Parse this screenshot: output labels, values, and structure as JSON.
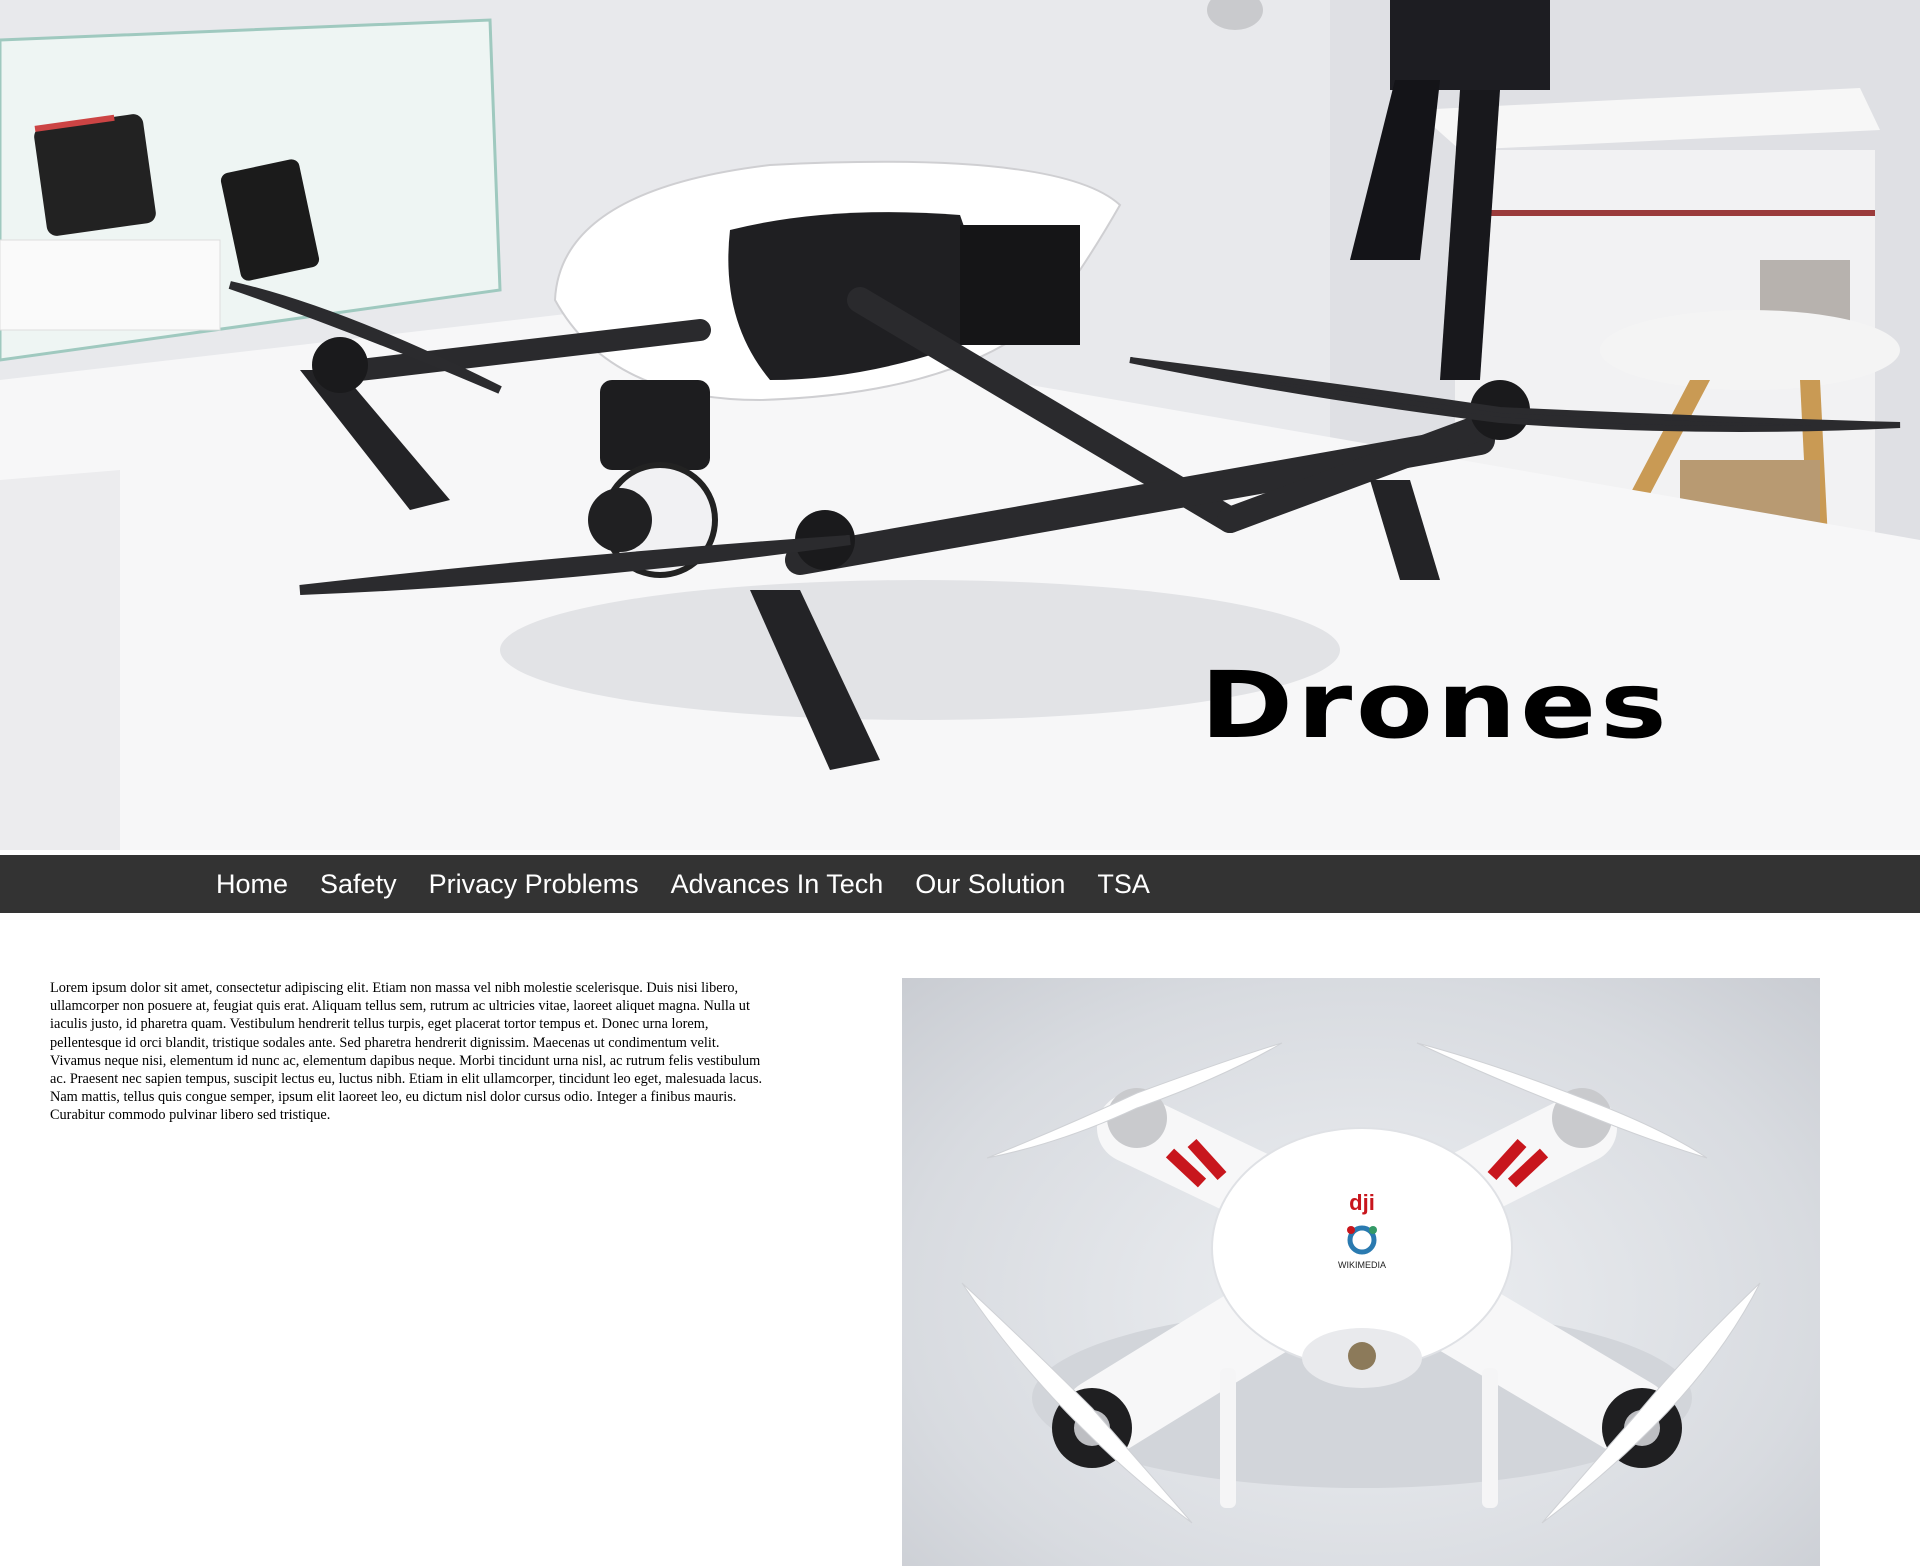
{
  "hero": {
    "title": "Drones"
  },
  "nav": {
    "items": [
      {
        "label": "Home"
      },
      {
        "label": "Safety"
      },
      {
        "label": "Privacy Problems"
      },
      {
        "label": "Advances In Tech"
      },
      {
        "label": "Our Solution"
      },
      {
        "label": "TSA"
      }
    ],
    "background": "#333333",
    "text_color": "#ffffff"
  },
  "main": {
    "paragraph": "Lorem ipsum dolor sit amet, consectetur adipiscing elit. Etiam non massa vel nibh molestie scelerisque. Duis nisi libero, ullamcorper non posuere at, feugiat quis erat. Aliquam tellus sem, rutrum ac ultricies vitae, laoreet aliquet magna. Nulla ut iaculis justo, id pharetra quam. Vestibulum hendrerit tellus turpis, eget placerat tortor tempus et. Donec urna lorem, pellentesque id orci blandit, tristique sodales ante. Sed pharetra hendrerit dignissim. Maecenas ut condimentum velit. Vivamus neque nisi, elementum id nunc ac, elementum dapibus neque. Morbi tincidunt urna nisl, ac rutrum felis vestibulum ac. Praesent nec sapien tempus, suscipit lectus eu, luctus nibh. Etiam in elit ullamcorper, tincidunt leo eget, malesuada lacus. Nam mattis, tellus quis congue semper, ipsum elit laoreet leo, eu dictum nisl dolor cursus odio. Integer a finibus mauris. Curabitur commodo pulvinar libero sed tristique."
  },
  "photo": {
    "brand_mark": "dji",
    "logo_text": "WIKIMEDIA"
  }
}
